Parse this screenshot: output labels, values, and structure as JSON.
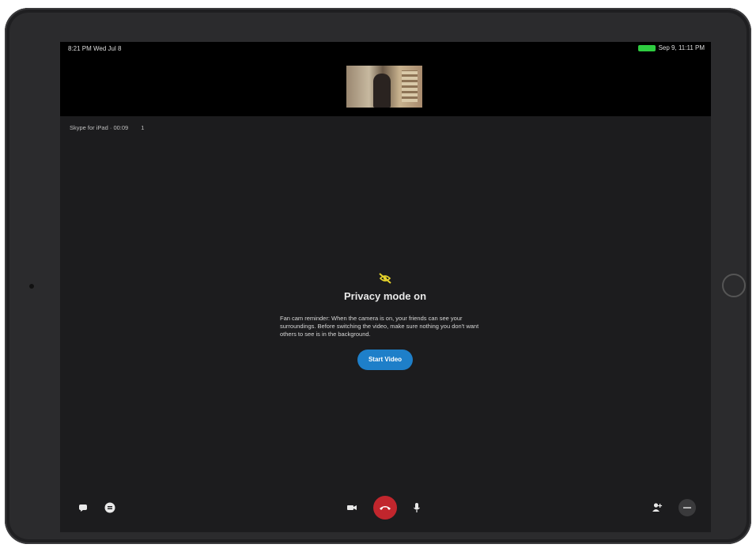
{
  "statusbar": {
    "left_text": "8:21 PM  Wed Jul 8",
    "right_text": "Sep 9, 11:11 PM"
  },
  "call": {
    "timer": "Skype for iPad · 00:09",
    "participants_indicator": "1"
  },
  "privacy_notice": {
    "icon": "privacy-icon",
    "title": "Privacy mode on",
    "body": "Fan cam reminder: When the camera is on, your friends can see your surroundings. Before switching the video, make sure nothing you don't want others to see is in the background.",
    "button_label": "Start Video"
  },
  "toolbar": {
    "left": [
      {
        "name": "chat-icon"
      },
      {
        "name": "more-options-icon"
      }
    ],
    "center": [
      {
        "name": "video-icon"
      },
      {
        "name": "end-call-icon"
      },
      {
        "name": "microphone-icon"
      }
    ],
    "right": [
      {
        "name": "add-participant-icon"
      },
      {
        "name": "ellipsis-icon"
      }
    ]
  },
  "colors": {
    "accent": "#1e7fc9",
    "end_call": "#c1262d",
    "icon_yellow": "#e6d32b",
    "battery": "#2ecc40"
  }
}
